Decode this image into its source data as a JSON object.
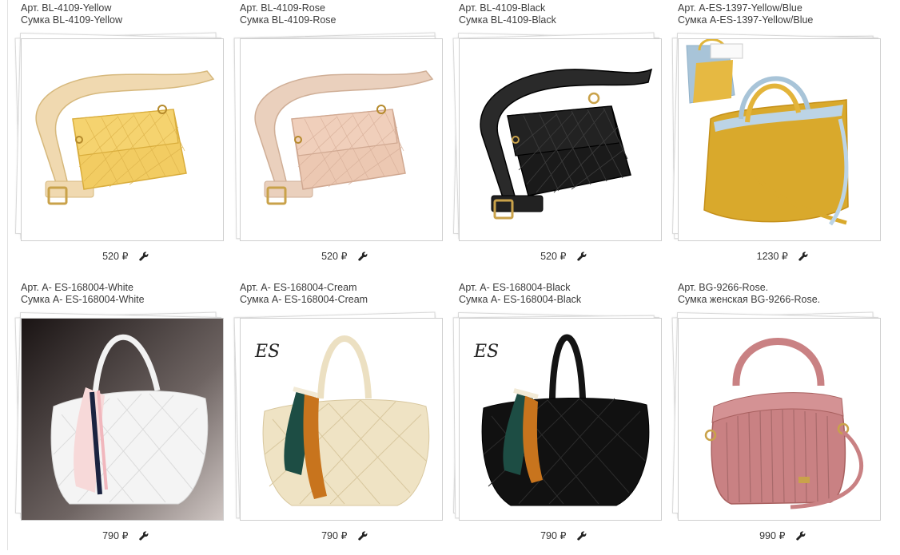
{
  "products": [
    {
      "article": "Арт. BL-4109-Yellow",
      "name": "Сумка BL-4109-Yellow",
      "price": "520 ₽",
      "photo_icon": "yellow-belt-bag",
      "color": "#f2cc62"
    },
    {
      "article": "Арт. BL-4109-Rose",
      "name": "Сумка BL-4109-Rose",
      "price": "520 ₽",
      "photo_icon": "rose-belt-bag",
      "color": "#ecc8b2"
    },
    {
      "article": "Арт. BL-4109-Black",
      "name": "Сумка BL-4109-Black",
      "price": "520 ₽",
      "photo_icon": "black-belt-bag",
      "color": "#1a1a1a"
    },
    {
      "article": "Арт. A-ES-1397-Yellow/Blue",
      "name": "Сумка A-ES-1397-Yellow/Blue",
      "price": "1230 ₽",
      "photo_icon": "yellow-blue-tote-bag",
      "color": "#d9a92c"
    },
    {
      "article": "Арт. A- ES-168004-White",
      "name": "Сумка A- ES-168004-White",
      "price": "790 ₽",
      "photo_icon": "white-woven-hobo-bag",
      "color": "#f4f4f4"
    },
    {
      "article": "Арт. A- ES-168004-Cream",
      "name": "Сумка A- ES-168004-Cream",
      "price": "790 ₽",
      "photo_icon": "cream-woven-hobo-bag",
      "color": "#efe3c4"
    },
    {
      "article": "Арт. A- ES-168004-Black",
      "name": "Сумка A- ES-168004-Black",
      "price": "790 ₽",
      "photo_icon": "black-woven-hobo-bag",
      "color": "#111111"
    },
    {
      "article": "Арт. BG-9266-Rose.",
      "name": "Сумка женская BG-9266-Rose.",
      "price": "990 ₽",
      "photo_icon": "rose-pleated-handbag",
      "color": "#c98183"
    }
  ],
  "edit_icon": "wrench-icon"
}
